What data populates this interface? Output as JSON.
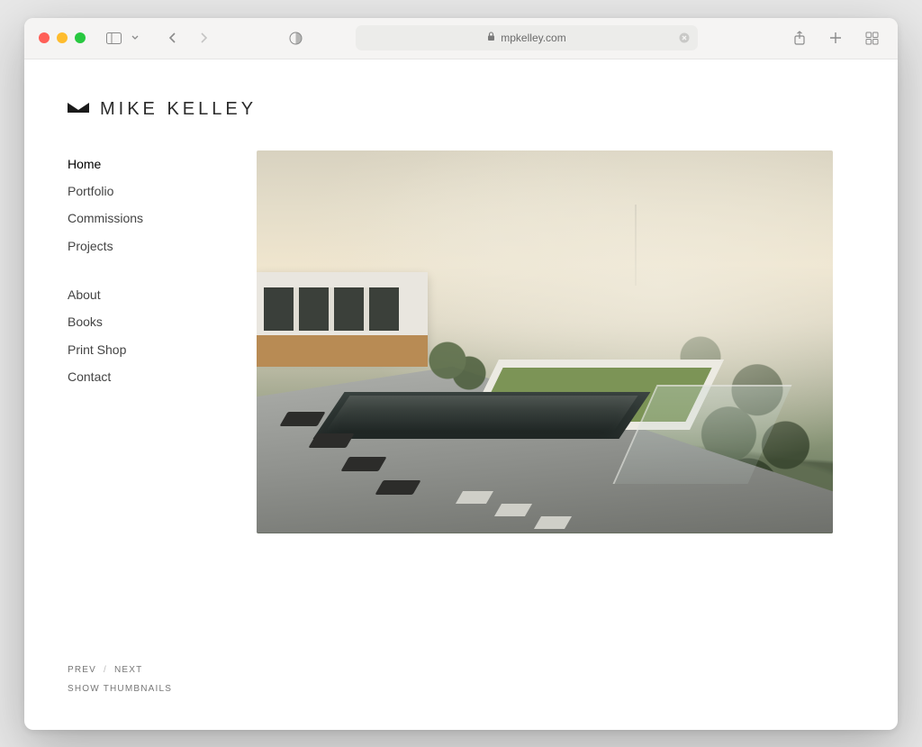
{
  "browser": {
    "url_host": "mpkelley.com"
  },
  "brand": {
    "name": "MIKE KELLEY"
  },
  "nav": {
    "group1": [
      {
        "label": "Home",
        "active": true
      },
      {
        "label": "Portfolio",
        "active": false
      },
      {
        "label": "Commissions",
        "active": false
      },
      {
        "label": "Projects",
        "active": false
      }
    ],
    "group2": [
      {
        "label": "About",
        "active": false
      },
      {
        "label": "Books",
        "active": false
      },
      {
        "label": "Print Shop",
        "active": false
      },
      {
        "label": "Contact",
        "active": false
      }
    ]
  },
  "controls": {
    "prev": "PREV",
    "separator": "/",
    "next": "NEXT",
    "thumbnails": "SHOW THUMBNAILS"
  }
}
